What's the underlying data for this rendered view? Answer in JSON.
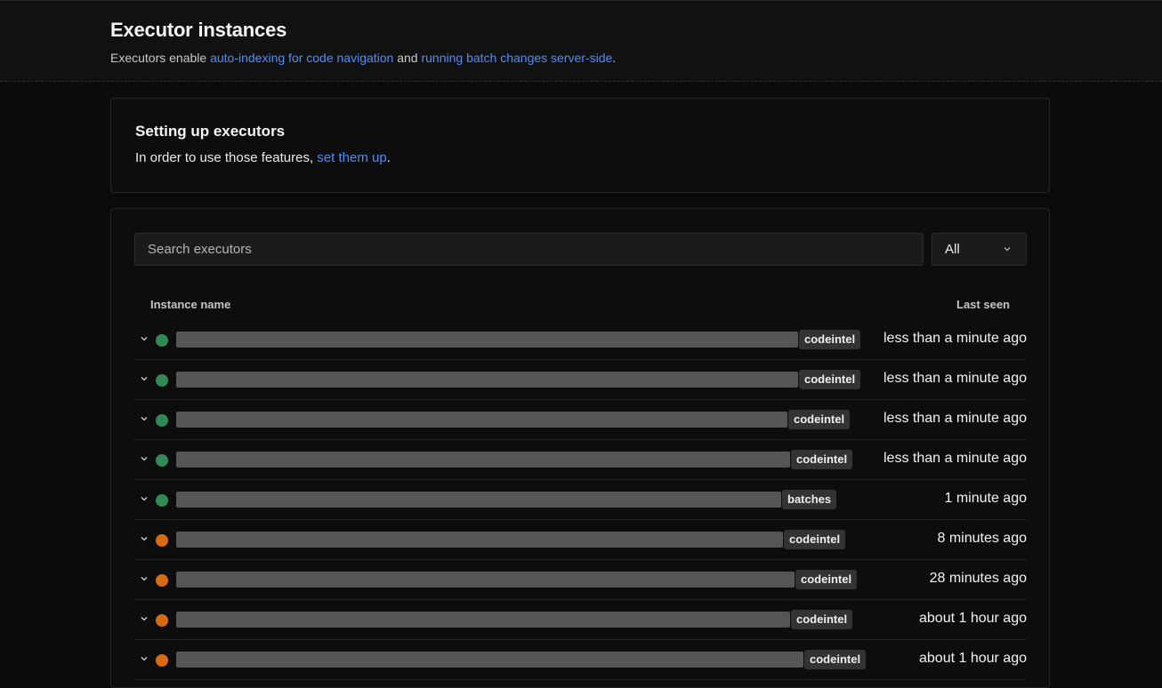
{
  "header": {
    "title": "Executor instances",
    "desc_prefix": "Executors enable ",
    "link_indexing": "auto-indexing for code navigation",
    "desc_mid": " and ",
    "link_batch": "running batch changes server-side",
    "desc_suffix": "."
  },
  "callout": {
    "title": "Setting up executors",
    "text_prefix": "In order to use those features, ",
    "link": "set them up",
    "text_suffix": "."
  },
  "filter": {
    "search_placeholder": "Search executors",
    "select_value": "All"
  },
  "table": {
    "col_name": "Instance name",
    "col_seen": "Last seen"
  },
  "colors": {
    "online": "#2e8b57",
    "stale": "#d86a10",
    "link": "#4d8ef7"
  },
  "rows": [
    {
      "status": "online",
      "queue": "codeintel",
      "last_seen": "less than a minute ago"
    },
    {
      "status": "online",
      "queue": "codeintel",
      "last_seen": "less than a minute ago"
    },
    {
      "status": "online",
      "queue": "codeintel",
      "last_seen": "less than a minute ago"
    },
    {
      "status": "online",
      "queue": "codeintel",
      "last_seen": "less than a minute ago"
    },
    {
      "status": "online",
      "queue": "batches",
      "last_seen": "1 minute ago"
    },
    {
      "status": "stale",
      "queue": "codeintel",
      "last_seen": "8 minutes ago"
    },
    {
      "status": "stale",
      "queue": "codeintel",
      "last_seen": "28 minutes ago"
    },
    {
      "status": "stale",
      "queue": "codeintel",
      "last_seen": "about 1 hour ago"
    },
    {
      "status": "stale",
      "queue": "codeintel",
      "last_seen": "about 1 hour ago"
    }
  ]
}
